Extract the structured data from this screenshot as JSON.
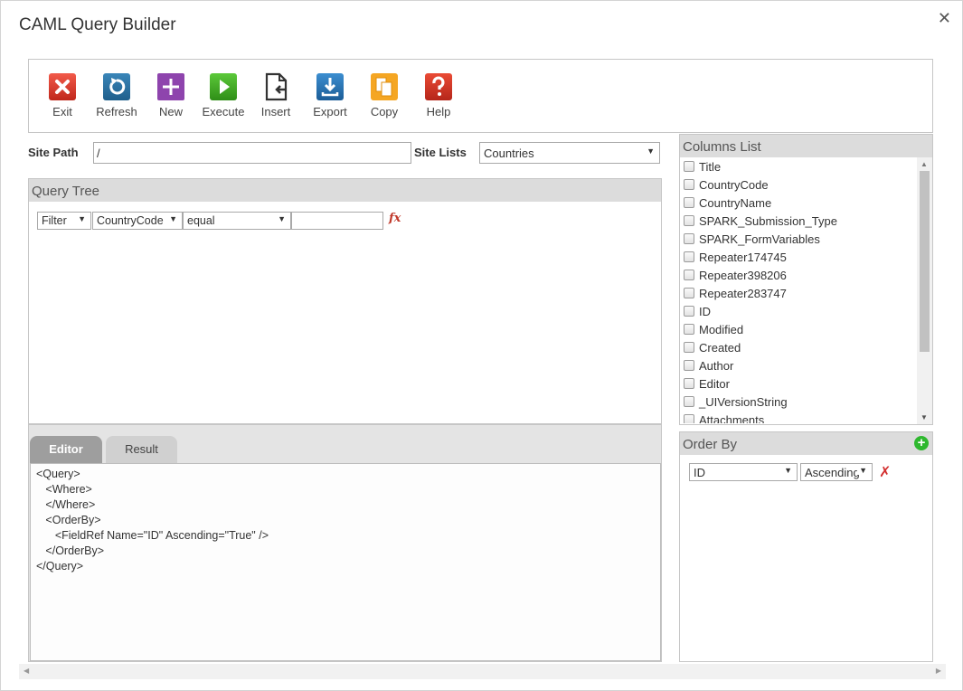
{
  "dialog": {
    "title": "CAML Query Builder",
    "close_glyph": "✕"
  },
  "toolbar": {
    "buttons": [
      {
        "label": "Exit",
        "icon": "exit-icon"
      },
      {
        "label": "Refresh",
        "icon": "refresh-icon"
      },
      {
        "label": "New",
        "icon": "new-icon"
      },
      {
        "label": "Execute",
        "icon": "execute-icon"
      },
      {
        "label": "Insert",
        "icon": "insert-icon"
      },
      {
        "label": "Export",
        "icon": "export-icon"
      },
      {
        "label": "Copy",
        "icon": "copy-icon"
      },
      {
        "label": "Help",
        "icon": "help-icon"
      }
    ]
  },
  "site": {
    "path_label": "Site Path",
    "path_value": "/",
    "lists_label": "Site Lists",
    "lists_value": "Countries"
  },
  "query_tree": {
    "header": "Query Tree",
    "row": {
      "type": "Filter",
      "field": "CountryCode",
      "operator": "equal",
      "value": ""
    },
    "fx_label": "fx"
  },
  "editor": {
    "tabs": [
      {
        "label": "Editor",
        "active": true
      },
      {
        "label": "Result",
        "active": false
      }
    ],
    "lines": [
      "<Query>",
      "   <Where>",
      "   </Where>",
      "   <OrderBy>",
      "      <FieldRef Name=\"ID\" Ascending=\"True\" />",
      "   </OrderBy>",
      "</Query>"
    ]
  },
  "columns": {
    "header": "Columns List",
    "items": [
      "Title",
      "CountryCode",
      "CountryName",
      "SPARK_Submission_Type",
      "SPARK_FormVariables",
      "Repeater174745",
      "Repeater398206",
      "Repeater283747",
      "ID",
      "Modified",
      "Created",
      "Author",
      "Editor",
      "_UIVersionString",
      "Attachments"
    ]
  },
  "order_by": {
    "header": "Order By",
    "field": "ID",
    "direction": "Ascending"
  },
  "colors": {
    "panel_header": "#dcdcdc",
    "tab_active": "#9e9e9e",
    "accent_green": "#2eb82e",
    "accent_red": "#d32f2f"
  }
}
